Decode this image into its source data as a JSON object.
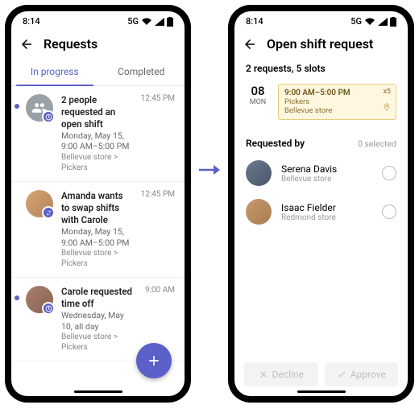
{
  "status": {
    "time": "8:14",
    "network": "5G"
  },
  "left": {
    "title": "Requests",
    "tabs": {
      "in_progress": "In progress",
      "completed": "Completed"
    },
    "items": [
      {
        "title": "2 people requested an open shift",
        "sub": "Monday, May 15, 9:00 AM–5:00 PM",
        "meta": "Bellevue store > Pickers",
        "time": "12:45 PM"
      },
      {
        "title": "Amanda wants to swap shifts with Carole",
        "sub": "Monday, May 15, 9:00 AM–5:00 PM",
        "meta": "Bellevue store > Pickers",
        "time": "12:45 PM"
      },
      {
        "title": "Carole requested time off",
        "sub": "Wednesday, May 10, all day",
        "meta": "Bellevue store > Pickers",
        "time": "9:00 AM"
      }
    ]
  },
  "right": {
    "title": "Open shift request",
    "summary": "2 requests, 5 slots",
    "date_num": "08",
    "date_day": "MON",
    "shift": {
      "time": "9:00 AM–5:00 PM",
      "role": "Pickers",
      "store": "Bellevue store",
      "x": "x5"
    },
    "requested_by": "Requested by",
    "selected": "0 selected",
    "people": [
      {
        "name": "Serena Davis",
        "store": "Bellevue store"
      },
      {
        "name": "Isaac Fielder",
        "store": "Redmond store"
      }
    ],
    "decline": "Decline",
    "approve": "Approve"
  }
}
